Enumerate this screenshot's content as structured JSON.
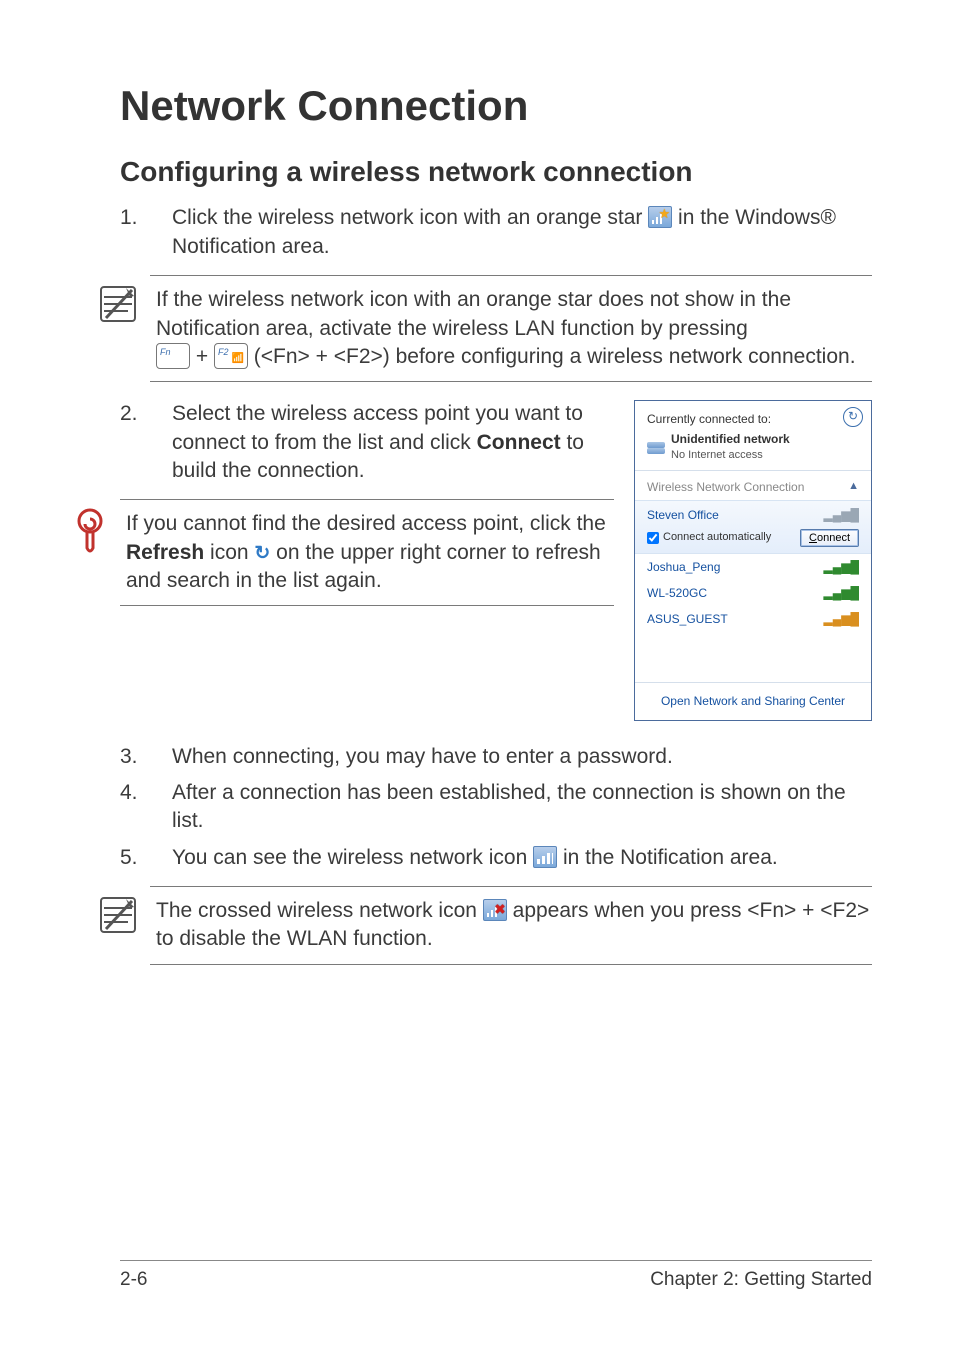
{
  "heading": "Network Connection",
  "subheading": "Configuring a wireless network connection",
  "step1": {
    "num": "1.",
    "a": "Click the wireless network icon with an orange star ",
    "b": " in the Windows® Notification area."
  },
  "note1": {
    "a": "If the wireless network icon with an orange star does not show in the Notification area, activate the wireless LAN function by pressing",
    "b": " + ",
    "c": " (<Fn> + <F2>) before configuring a wireless network connection.",
    "key1": {
      "tl": "Fn"
    },
    "key2": {
      "tl": "F2"
    }
  },
  "step2": {
    "num": "2.",
    "a": "Select the wireless access point you want to connect to from the list and click ",
    "bold": "Connect",
    "b": " to build the connection."
  },
  "tip": {
    "a": "If you cannot find the desired access point, click the ",
    "bold": "Refresh",
    "b": " icon ",
    "c": " on the upper right corner to refresh and search in the list again."
  },
  "step3": {
    "num": "3.",
    "text": "When connecting, you may have to enter a password."
  },
  "step4": {
    "num": "4.",
    "text": "After a connection has been established, the connection is shown on the list."
  },
  "step5": {
    "num": "5.",
    "a": "You can see the wireless network icon ",
    "b": " in the Notification area."
  },
  "note2": {
    "a": "The crossed wireless network icon ",
    "b": " appears when you press <Fn> + <F2> to disable the WLAN function."
  },
  "popup": {
    "currently": "Currently connected to:",
    "unidentified": "Unidentified network",
    "noaccess": "No Internet access",
    "refresh_badge": "↻",
    "section": "Wireless Network Connection",
    "chev": "▲",
    "selected": {
      "name": "Steven Office",
      "chk_label": "Connect automatically",
      "btn_u": "C",
      "btn_rest": "onnect"
    },
    "items": [
      {
        "name": "Joshua_Peng",
        "sig": "green"
      },
      {
        "name": "WL-520GC",
        "sig": "green"
      },
      {
        "name": "ASUS_GUEST",
        "sig": "orange"
      }
    ],
    "footer": "Open Network and Sharing Center"
  },
  "pagefoot": {
    "left": "2-6",
    "right": "Chapter 2: Getting Started"
  }
}
